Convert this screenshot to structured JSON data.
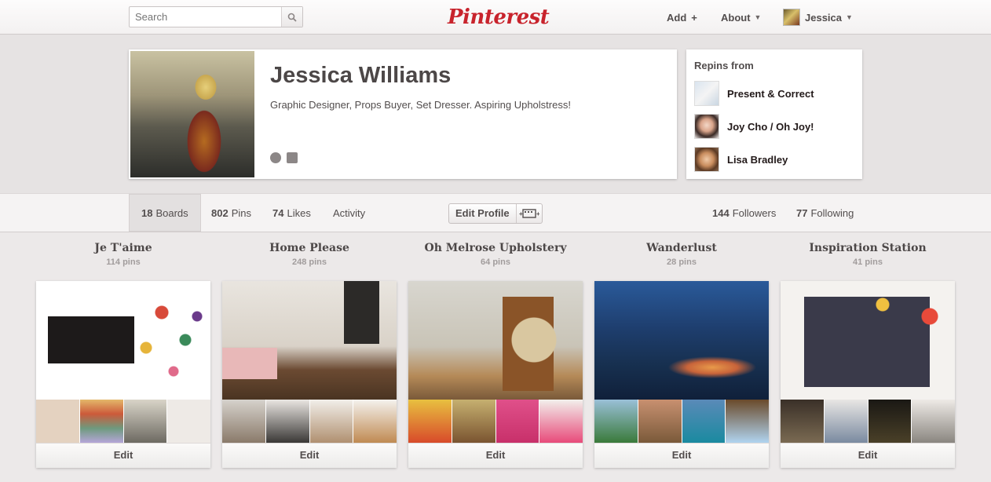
{
  "header": {
    "search_placeholder": "Search",
    "logo": "Pinterest",
    "add_label": "Add",
    "about_label": "About",
    "user_label": "Jessica"
  },
  "profile": {
    "name": "Jessica Williams",
    "bio": "Graphic Designer, Props Buyer, Set Dresser. Aspiring Upholstress!"
  },
  "repins": {
    "title": "Repins from",
    "items": [
      {
        "name": "Present & Correct"
      },
      {
        "name": "Joy Cho / Oh Joy!"
      },
      {
        "name": "Lisa Bradley"
      }
    ]
  },
  "tabs": {
    "boards_count": "18",
    "boards_label": "Boards",
    "pins_count": "802",
    "pins_label": "Pins",
    "likes_count": "74",
    "likes_label": "Likes",
    "activity_label": "Activity",
    "edit_profile_label": "Edit Profile",
    "followers_count": "144",
    "followers_label": "Followers",
    "following_count": "77",
    "following_label": "Following"
  },
  "boards": [
    {
      "title": "Je T'aime",
      "count": "114 pins",
      "edit": "Edit"
    },
    {
      "title": "Home Please",
      "count": "248 pins",
      "edit": "Edit"
    },
    {
      "title": "Oh Melrose Upholstery",
      "count": "64 pins",
      "edit": "Edit"
    },
    {
      "title": "Wanderlust",
      "count": "28 pins",
      "edit": "Edit"
    },
    {
      "title": "Inspiration Station",
      "count": "41 pins",
      "edit": "Edit"
    }
  ],
  "colors": {
    "brand_red": "#c8232c",
    "page_bg": "#ece9e9",
    "text": "#524d4d"
  }
}
